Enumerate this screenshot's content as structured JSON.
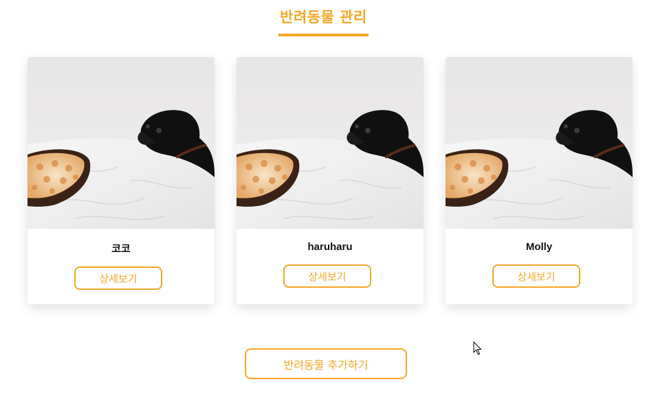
{
  "header": {
    "title": "반려동물 관리"
  },
  "pets": [
    {
      "name": "코코",
      "detail_label": "상세보기"
    },
    {
      "name": "haruharu",
      "detail_label": "상세보기"
    },
    {
      "name": "Molly",
      "detail_label": "상세보기"
    }
  ],
  "actions": {
    "add_label": "반려동물 추가하기"
  },
  "colors": {
    "accent": "#f5a623",
    "background": "#ffffff",
    "text": "#111111"
  },
  "icons": {
    "cursor": "arrow-cursor-icon"
  }
}
